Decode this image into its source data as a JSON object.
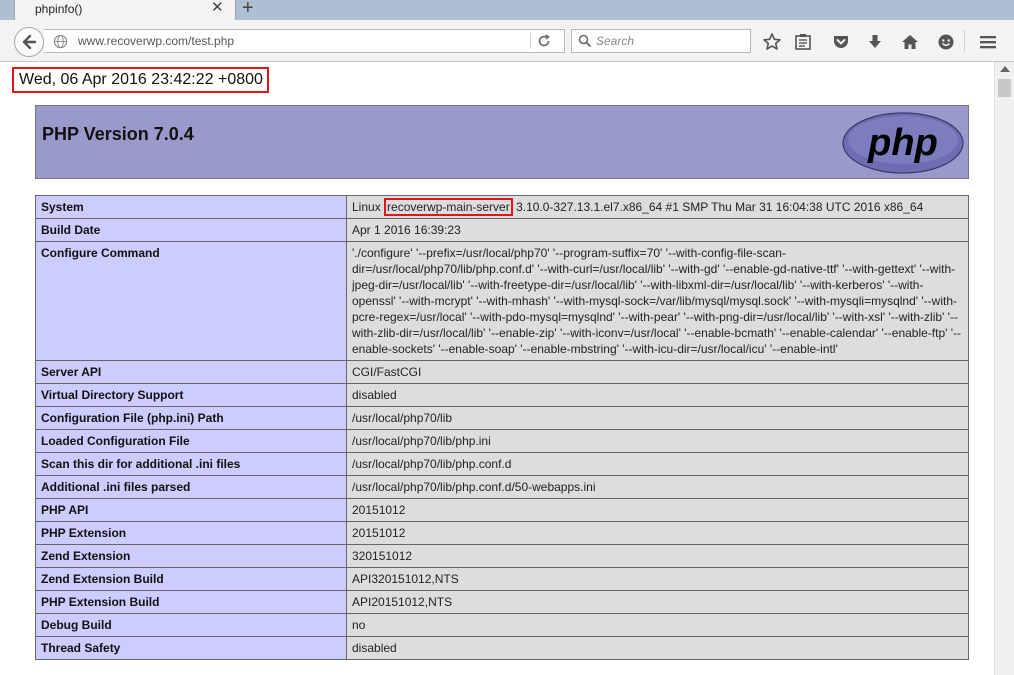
{
  "browser": {
    "tab_title": "phpinfo()",
    "url": "www.recoverwp.com/test.php",
    "search_placeholder": "Search"
  },
  "page": {
    "date": "Wed, 06 Apr 2016 23:42:22 +0800",
    "header_title": "PHP Version 7.0.4",
    "logo_text": "php",
    "system": {
      "label": "System",
      "prefix": "Linux ",
      "hostname": "recoverwp-main-server",
      "suffix": " 3.10.0-327.13.1.el7.x86_64 #1 SMP Thu Mar 31 16:04:38 UTC 2016 x86_64"
    },
    "rows": [
      {
        "label": "Build Date",
        "value": "Apr 1 2016 16:39:23"
      },
      {
        "label": "Configure Command",
        "value": "'./configure' '--prefix=/usr/local/php70' '--program-suffix=70' '--with-config-file-scan-dir=/usr/local/php70/lib/php.conf.d' '--with-curl=/usr/local/lib' '--with-gd' '--enable-gd-native-ttf' '--with-gettext' '--with-jpeg-dir=/usr/local/lib' '--with-freetype-dir=/usr/local/lib' '--with-libxml-dir=/usr/local/lib' '--with-kerberos' '--with-openssl' '--with-mcrypt' '--with-mhash' '--with-mysql-sock=/var/lib/mysql/mysql.sock' '--with-mysqli=mysqlnd' '--with-pcre-regex=/usr/local' '--with-pdo-mysql=mysqlnd' '--with-pear' '--with-png-dir=/usr/local/lib' '--with-xsl' '--with-zlib' '--with-zlib-dir=/usr/local/lib' '--enable-zip' '--with-iconv=/usr/local' '--enable-bcmath' '--enable-calendar' '--enable-ftp' '--enable-sockets' '--enable-soap' '--enable-mbstring' '--with-icu-dir=/usr/local/icu' '--enable-intl'"
      },
      {
        "label": "Server API",
        "value": "CGI/FastCGI"
      },
      {
        "label": "Virtual Directory Support",
        "value": "disabled"
      },
      {
        "label": "Configuration File (php.ini) Path",
        "value": "/usr/local/php70/lib"
      },
      {
        "label": "Loaded Configuration File",
        "value": "/usr/local/php70/lib/php.ini"
      },
      {
        "label": "Scan this dir for additional .ini files",
        "value": "/usr/local/php70/lib/php.conf.d"
      },
      {
        "label": "Additional .ini files parsed",
        "value": "/usr/local/php70/lib/php.conf.d/50-webapps.ini"
      },
      {
        "label": "PHP API",
        "value": "20151012"
      },
      {
        "label": "PHP Extension",
        "value": "20151012"
      },
      {
        "label": "Zend Extension",
        "value": "320151012"
      },
      {
        "label": "Zend Extension Build",
        "value": "API320151012,NTS"
      },
      {
        "label": "PHP Extension Build",
        "value": "API20151012,NTS"
      },
      {
        "label": "Debug Build",
        "value": "no"
      },
      {
        "label": "Thread Safety",
        "value": "disabled"
      }
    ]
  },
  "colors": {
    "header_bg": "#9999cc",
    "label_bg": "#ccccff",
    "value_bg": "#dddddd",
    "highlight": "#e0141e"
  }
}
